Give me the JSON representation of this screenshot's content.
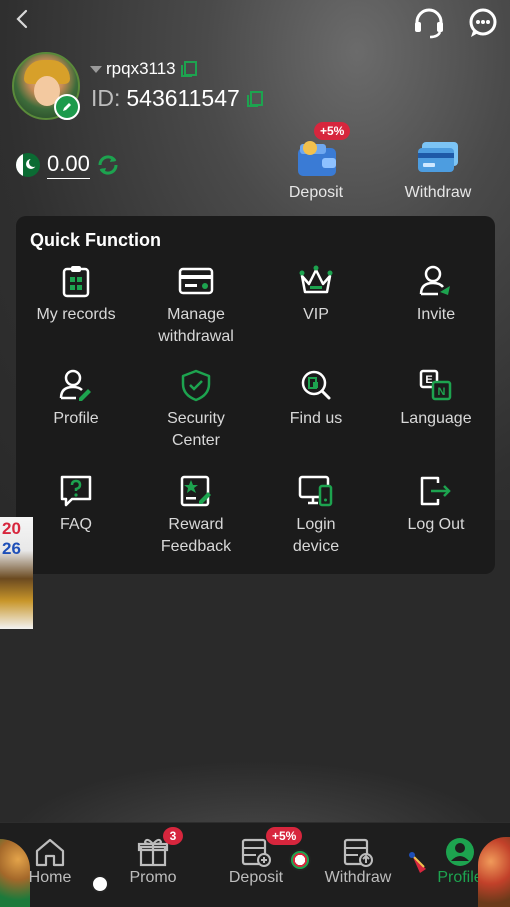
{
  "header": {
    "back_icon": "chevron-left-icon",
    "support_icon": "headset-icon",
    "chat_icon": "chat-bubble-icon"
  },
  "user": {
    "username": "rpqx3113",
    "id_label": "ID:",
    "id_value": "543611547",
    "balance": "0.00",
    "currency_icon": "pakistan-flag-icon"
  },
  "wallet": {
    "deposit_label": "Deposit",
    "deposit_badge": "+5%",
    "withdraw_label": "Withdraw"
  },
  "quick_function": {
    "title": "Quick Function",
    "items": [
      {
        "label": "My records",
        "icon": "clipboard-icon"
      },
      {
        "label": "Manage\nwithdrawal",
        "icon": "card-icon"
      },
      {
        "label": "VIP",
        "icon": "crown-icon"
      },
      {
        "label": "Invite",
        "icon": "user-invite-icon"
      },
      {
        "label": "Profile",
        "icon": "profile-edit-icon"
      },
      {
        "label": "Security\nCenter",
        "icon": "shield-check-icon"
      },
      {
        "label": "Find us",
        "icon": "search-doc-icon"
      },
      {
        "label": "Language",
        "icon": "language-icon"
      },
      {
        "label": "FAQ",
        "icon": "question-bubble-icon"
      },
      {
        "label": "Reward\nFeedback",
        "icon": "feedback-icon"
      },
      {
        "label": "Login\ndevice",
        "icon": "device-icon"
      },
      {
        "label": "Log Out",
        "icon": "logout-icon"
      }
    ]
  },
  "side_banner": {
    "line1": "20",
    "line2": "26"
  },
  "tabbar": {
    "tabs": [
      {
        "label": "Home",
        "icon": "home-icon"
      },
      {
        "label": "Promo",
        "icon": "gift-icon",
        "badge": "3"
      },
      {
        "label": "Deposit",
        "icon": "deposit-icon",
        "badge": "+5%"
      },
      {
        "label": "Withdraw",
        "icon": "withdraw-icon"
      },
      {
        "label": "Profile",
        "icon": "profile-icon"
      }
    ]
  },
  "colors": {
    "accent": "#1da34f",
    "badge": "#d7263d",
    "panel": "#1b1b1b"
  }
}
